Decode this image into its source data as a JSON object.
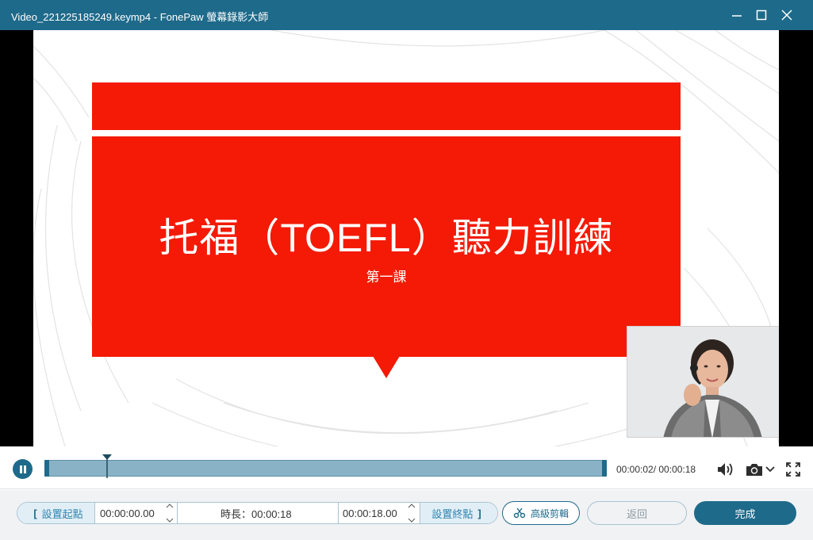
{
  "window": {
    "title": "Video_221225185249.keymp4  -  FonePaw 螢幕錄影大師",
    "minimize_icon": "minimize-icon",
    "maximize_icon": "maximize-icon",
    "close_icon": "close-icon"
  },
  "slide": {
    "title": "托福（TOEFL）聽力訓練",
    "subtitle": "第一課",
    "accent_color": "#f41a06"
  },
  "player": {
    "state_icon": "pause-icon",
    "progress_fraction": 0.11,
    "time_display": "00:00:02/ 00:00:18",
    "volume_icon": "volume-icon",
    "camera_icon": "camera-icon",
    "camera_dropdown_icon": "chevron-down-icon",
    "fullscreen_icon": "fullscreen-icon"
  },
  "trim": {
    "set_start_label": "設置起點",
    "start_value": "00:00:00.00",
    "duration_label": "時長：00:00:18",
    "end_value": "00:00:18.00",
    "set_end_label": "設置終點"
  },
  "actions": {
    "advanced_label": "高級剪輯",
    "back_label": "返回",
    "done_label": "完成"
  },
  "colors": {
    "primary": "#1e6a8a",
    "timeline": "#8ab2c7"
  }
}
